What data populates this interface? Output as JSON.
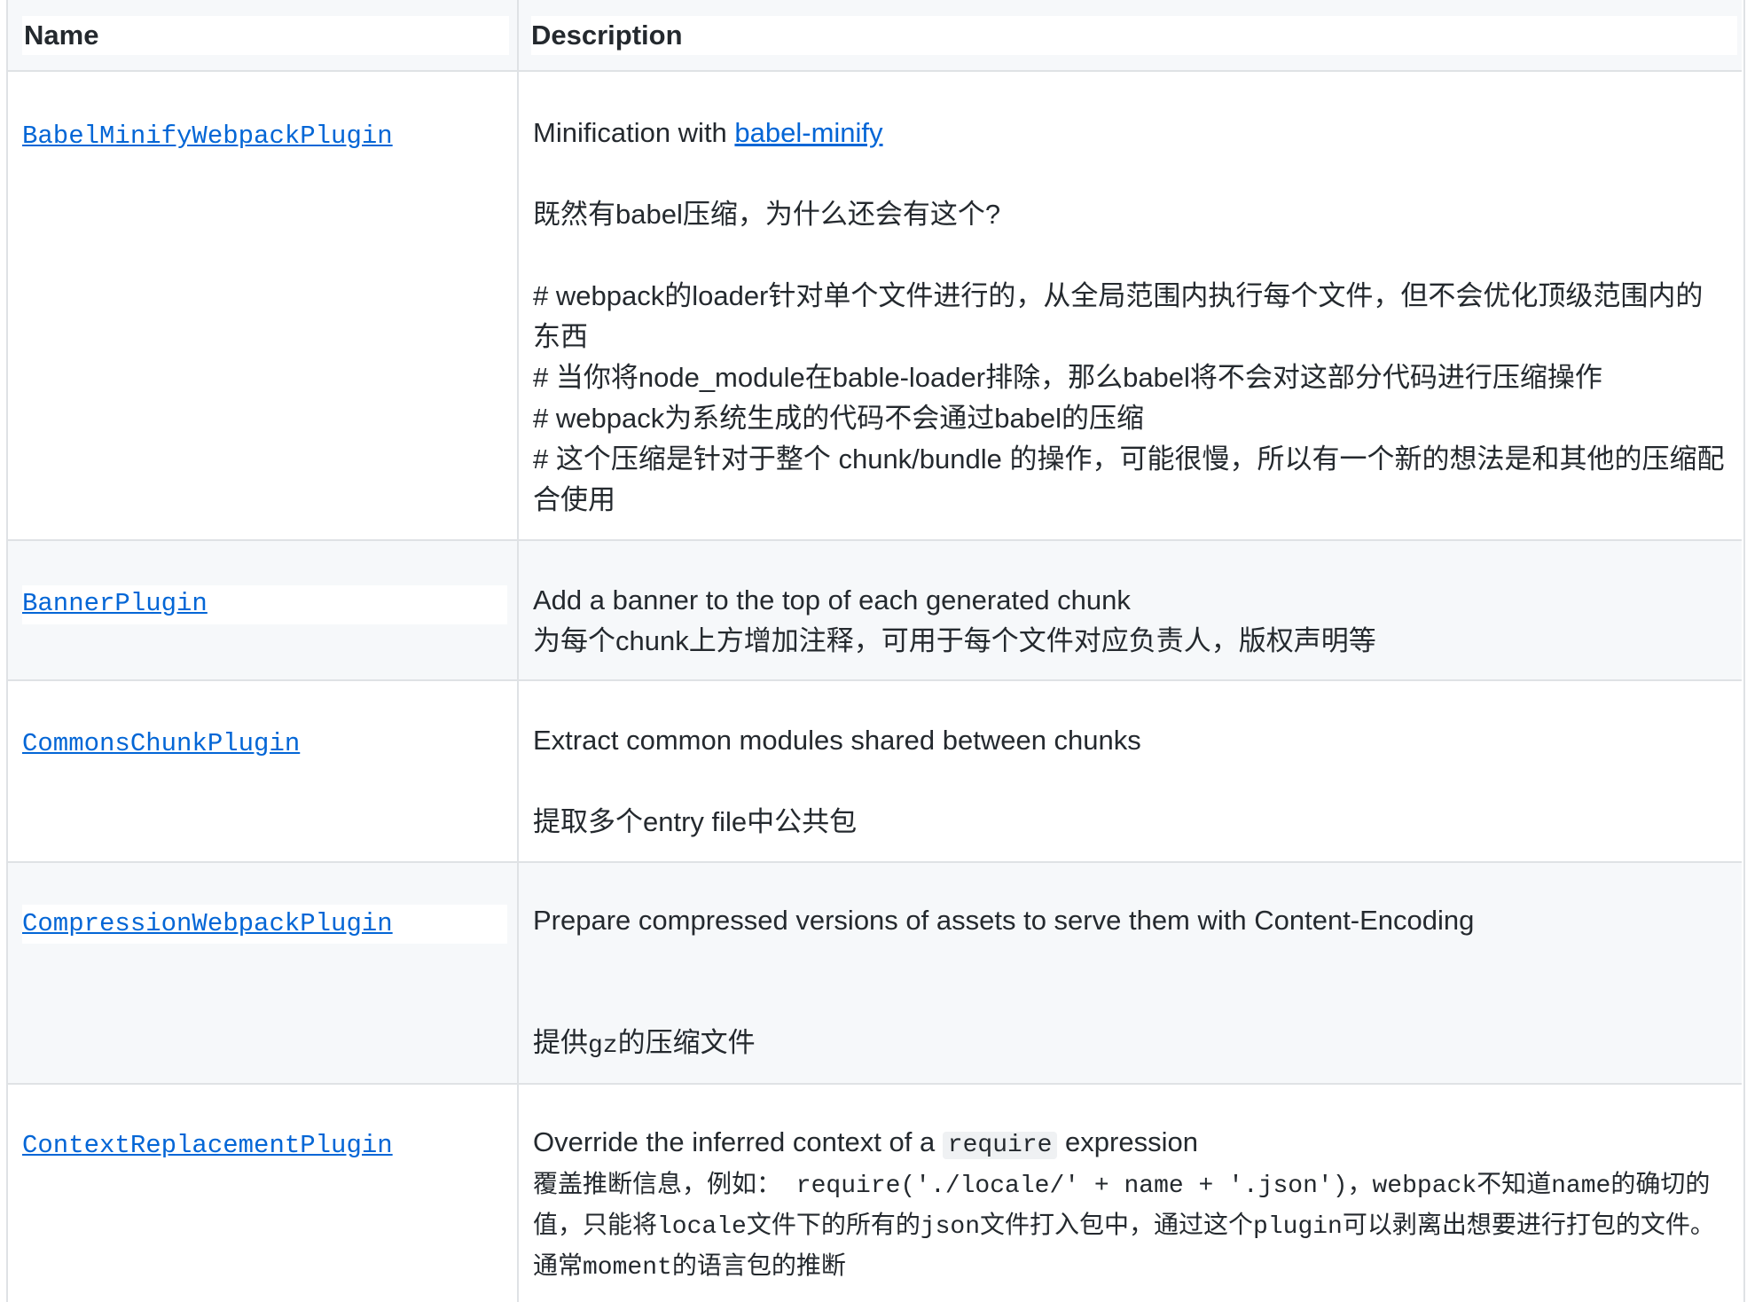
{
  "header": {
    "name": "Name",
    "description": "Description"
  },
  "rows": [
    {
      "name": "BabelMinifyWebpackPlugin",
      "desc_prefix": "Minification with ",
      "desc_link": "babel-minify",
      "lines": [
        "既然有babel压缩，为什么还会有这个?",
        "# webpack的loader针对单个文件进行的，从全局范围内执行每个文件，但不会优化顶级范围内的东西",
        "# 当你将node_module在bable-loader排除，那么babel将不会对这部分代码进行压缩操作",
        "# webpack为系统生成的代码不会通过babel的压缩",
        "# 这个压缩是针对于整个 chunk/bundle 的操作，可能很慢，所以有一个新的想法是和其他的压缩配合使用"
      ]
    },
    {
      "name": "BannerPlugin",
      "lines": [
        "Add a banner to the top of each generated chunk",
        "为每个chunk上方增加注释，可用于每个文件对应负责人，版权声明等"
      ]
    },
    {
      "name": "CommonsChunkPlugin",
      "lines": [
        "Extract common modules shared between chunks",
        "提取多个entry file中公共包"
      ]
    },
    {
      "name": "CompressionWebpackPlugin",
      "lines": [
        "Prepare compressed versions of assets to serve them with Content-Encoding"
      ],
      "cn_a": "提供",
      "cn_code": "gz",
      "cn_b": "的压缩文件"
    },
    {
      "name": "ContextReplacementPlugin",
      "desc_a": "Override the inferred context of a ",
      "desc_code": "require",
      "desc_b": " expression",
      "cn_text": "覆盖推断信息，例如： require('./locale/' + name + '.json')，webpack不知道name的确切的值，只能将locale文件下的所有的json文件打入包中，通过这个plugin可以剥离出想要进行打包的文件。通常moment的语言包的推断"
    }
  ]
}
